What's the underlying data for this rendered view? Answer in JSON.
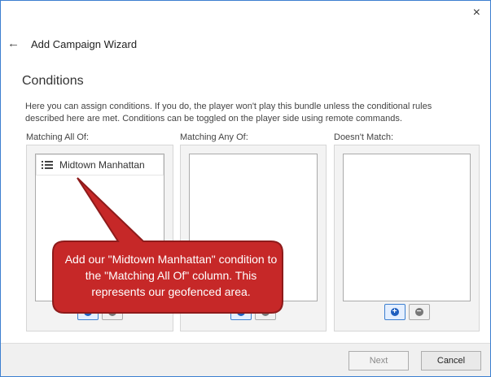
{
  "window": {
    "close_label": "×"
  },
  "header": {
    "back_label": "←",
    "title": "Add Campaign Wizard"
  },
  "conditions": {
    "section_title": "Conditions",
    "description": "Here you can assign conditions. If you do, the player won't play this bundle unless the conditional rules described here are met. Conditions can be toggled on the player side using remote commands."
  },
  "columns": [
    {
      "label": "Matching All Of:",
      "items": [
        {
          "icon": "list-icon",
          "text": "Midtown Manhattan"
        }
      ]
    },
    {
      "label": "Matching Any Of:",
      "items": []
    },
    {
      "label": "Doesn't Match:",
      "items": []
    }
  ],
  "buttons": {
    "add_label": "+",
    "remove_label": "−"
  },
  "footer": {
    "next_label": "Next",
    "cancel_label": "Cancel"
  },
  "callout": {
    "text": "Add our \"Midtown Manhattan\" condition to the \"Matching All Of\" column. This represents our geofenced area.",
    "color": "#c62828"
  }
}
